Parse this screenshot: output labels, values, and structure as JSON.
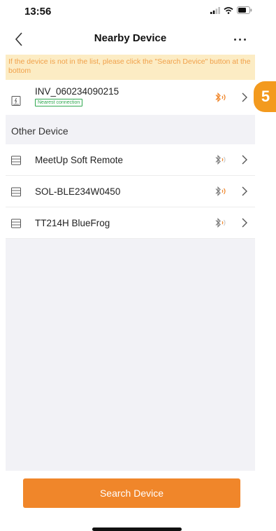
{
  "status_bar": {
    "time": "13:56"
  },
  "header": {
    "title": "Nearby Device"
  },
  "notice": {
    "text": "If the device is not in the list, please click the \"Search Device\" button at the bottom"
  },
  "nearest": {
    "name": "INV_060234090215",
    "badge": "Nearest connection",
    "bluetooth_color": "#f0862a"
  },
  "step_badge": {
    "number": "5",
    "color": "#f39a1e"
  },
  "other_section": {
    "title": "Other Device",
    "devices": [
      {
        "name": "MeetUp Soft Remote"
      },
      {
        "name": "SOL-BLE234W0450"
      },
      {
        "name": "TT214H BlueFrog"
      }
    ]
  },
  "footer": {
    "search_button_label": "Search Device",
    "accent": "#f0862a"
  },
  "icons": {
    "back": "chevron-left-icon",
    "more": "more-dots-icon",
    "device": "device-icon",
    "bluetooth": "bluetooth-icon",
    "row_arrow": "chevron-right-icon"
  }
}
